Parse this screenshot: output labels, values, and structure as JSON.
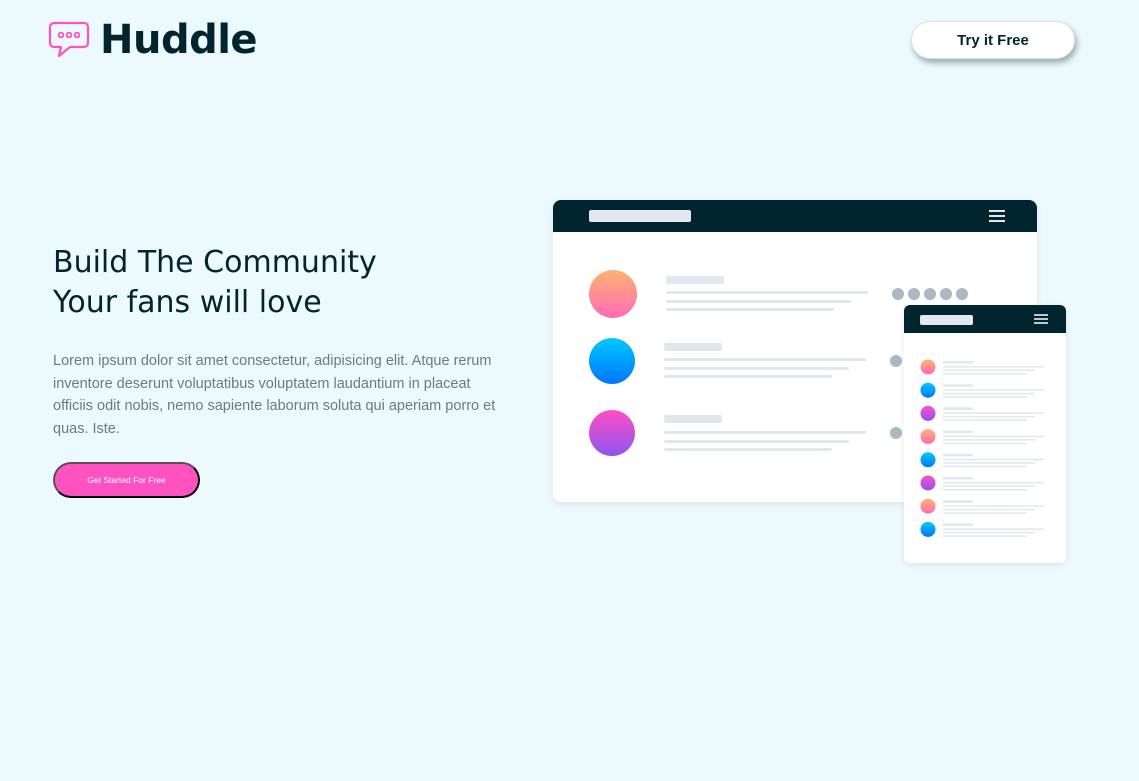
{
  "header": {
    "logo_text": "Huddle",
    "cta_label": "Try it Free"
  },
  "hero": {
    "title_line1": "Build The Community",
    "title_line2": "Your fans will love",
    "description": "Lorem ipsum dolor sit amet consectetur, adipisicing elit. Atque rerum inventore deserunt voluptatibus voluptatem laudantium in placeat officiis odit nobis, nemo sapiente laborum soluta qui aperiam porro et quas. Iste.",
    "cta_label": "Get Started For Free"
  },
  "colors": {
    "background": "#ecf9fd",
    "dark": "#00252e",
    "accent_pink": "#ff52c1",
    "muted_text": "#6b7b83"
  },
  "illustration": {
    "desktop_rows": [
      {
        "avatar": "orange-gradient"
      },
      {
        "avatar": "blue-gradient"
      },
      {
        "avatar": "purple-gradient"
      }
    ],
    "mobile_rows": [
      {
        "avatar": "orange-gradient"
      },
      {
        "avatar": "blue-gradient"
      },
      {
        "avatar": "purple-gradient"
      },
      {
        "avatar": "orange-gradient"
      },
      {
        "avatar": "blue-gradient"
      },
      {
        "avatar": "purple-gradient"
      },
      {
        "avatar": "orange-gradient"
      },
      {
        "avatar": "blue-gradient"
      }
    ]
  }
}
